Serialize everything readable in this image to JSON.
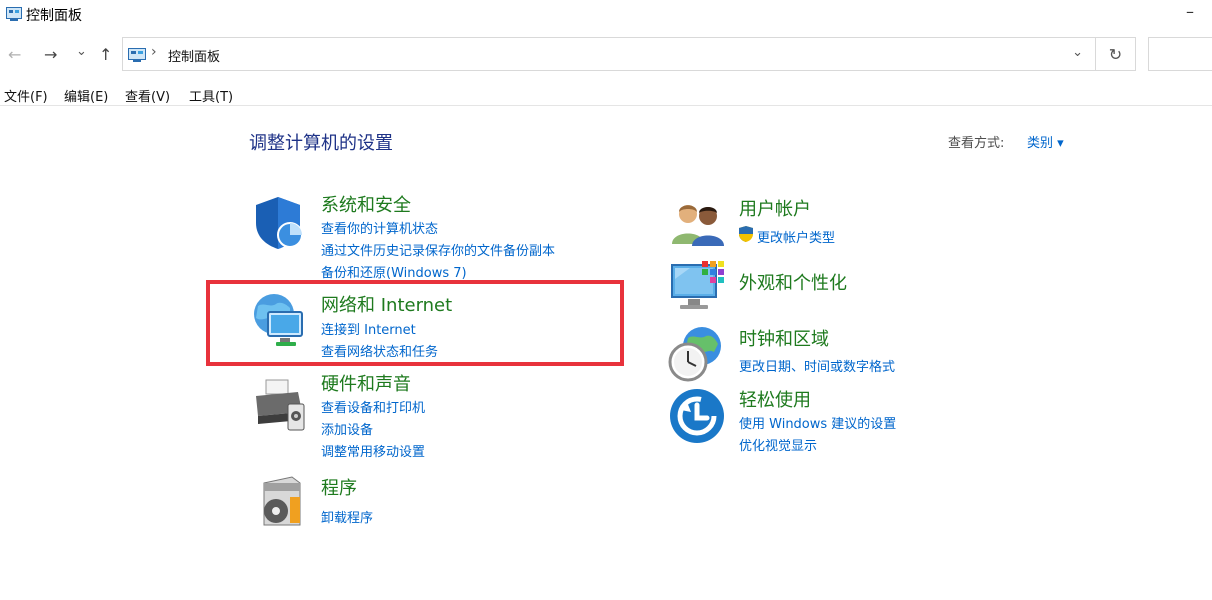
{
  "window": {
    "title": "控制面板",
    "minimize": "–"
  },
  "nav": {
    "back": "←",
    "forward": "→",
    "recent": "⌄",
    "up": "↑",
    "path_sep": "›",
    "path": "控制面板",
    "dropdown": "⌄",
    "refresh": "↻"
  },
  "menu": {
    "file": "文件(F)",
    "edit": "编辑(E)",
    "view": "查看(V)",
    "tools": "工具(T)"
  },
  "main": {
    "heading": "调整计算机的设置",
    "view_by_label": "查看方式:",
    "view_by_value": "类别 ▾"
  },
  "left": [
    {
      "title": "系统和安全",
      "icon": "shield-icon",
      "links": [
        "查看你的计算机状态",
        "通过文件历史记录保存你的文件备份副本",
        "备份和还原(Windows 7)"
      ]
    },
    {
      "title": "网络和 Internet",
      "icon": "network-icon",
      "links": [
        "连接到 Internet",
        "查看网络状态和任务"
      ]
    },
    {
      "title": "硬件和声音",
      "icon": "printer-icon",
      "links": [
        "查看设备和打印机",
        "添加设备",
        "调整常用移动设置"
      ]
    },
    {
      "title": "程序",
      "icon": "programs-icon",
      "links": [
        "卸载程序"
      ]
    }
  ],
  "right": [
    {
      "title": "用户帐户",
      "icon": "users-icon",
      "links": [
        "更改帐户类型"
      ]
    },
    {
      "title": "外观和个性化",
      "icon": "display-icon",
      "links": []
    },
    {
      "title": "时钟和区域",
      "icon": "clock-icon",
      "links": [
        "更改日期、时间或数字格式"
      ]
    },
    {
      "title": "轻松使用",
      "icon": "accessibility-icon",
      "links": [
        "使用 Windows 建议的设置",
        "优化视觉显示"
      ]
    }
  ],
  "colors": {
    "title_green": "#1e7a1e",
    "link_blue": "#0066cc",
    "heading_blue": "#1e3287",
    "highlight_red": "#e8323c"
  }
}
